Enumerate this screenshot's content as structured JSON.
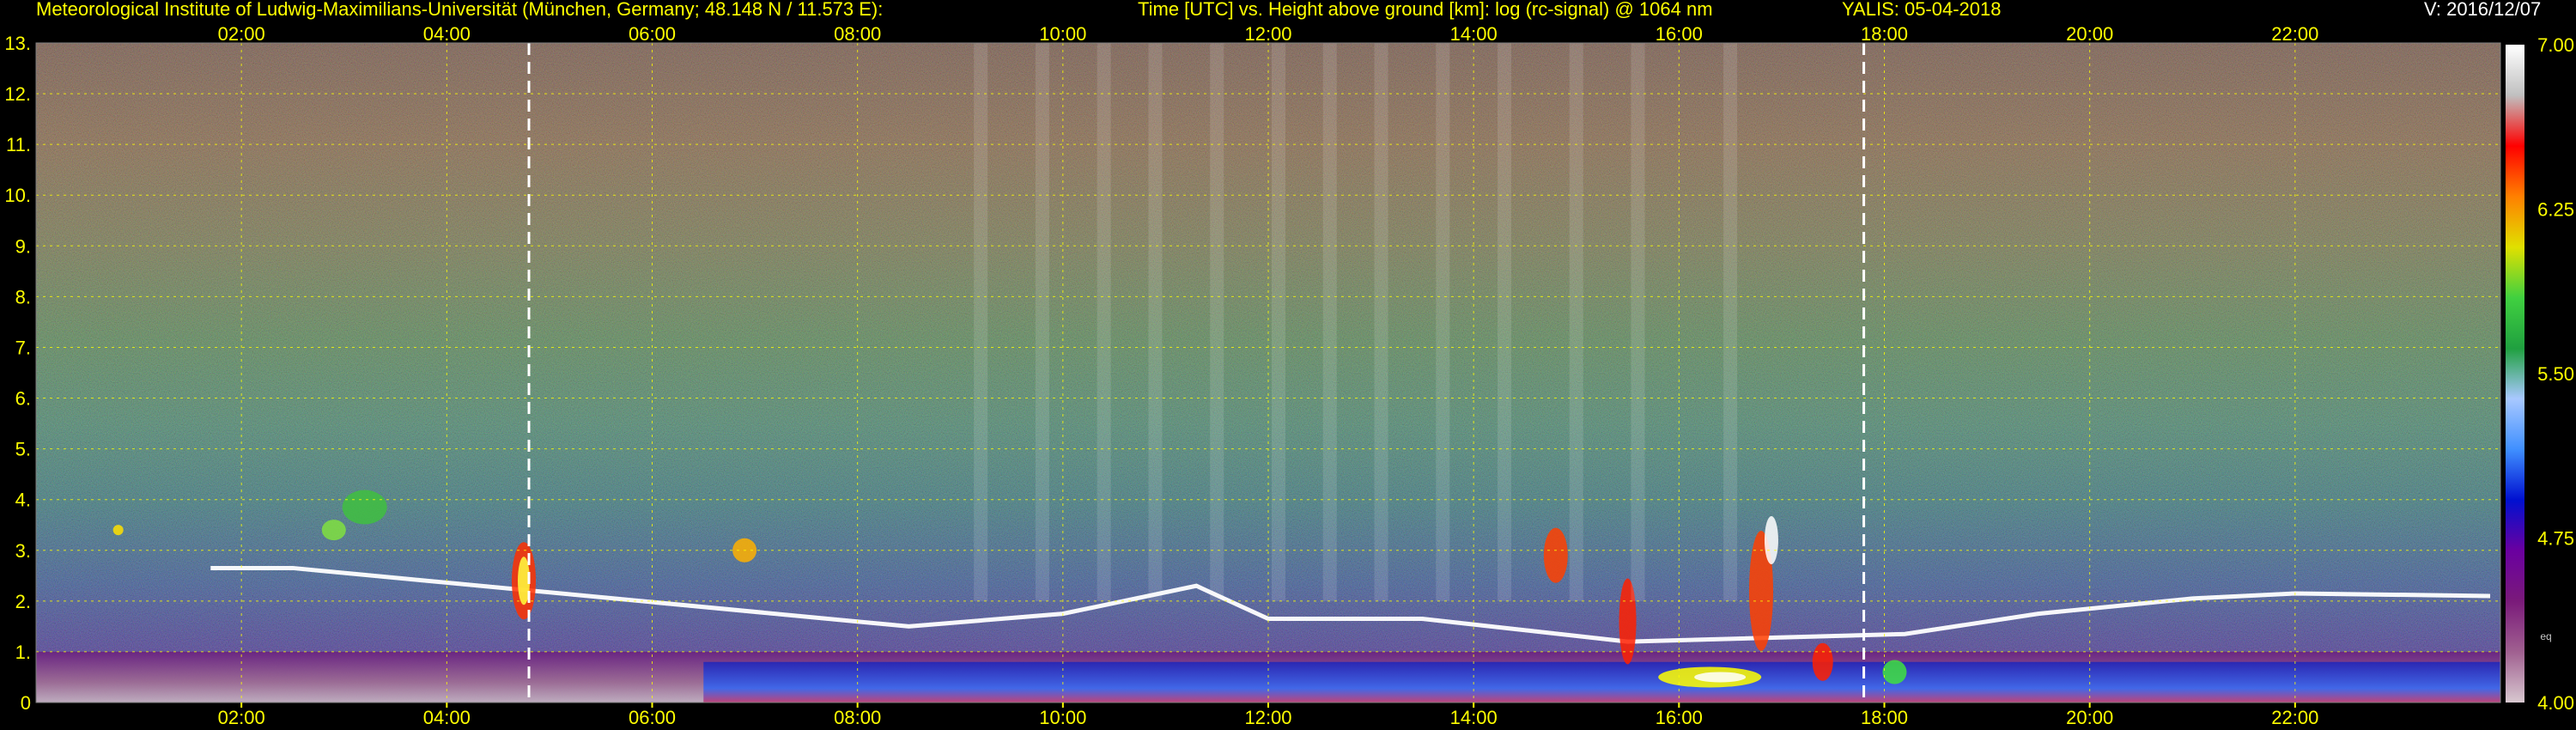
{
  "header": {
    "institute": "Meteorological Institute of Ludwig-Maximilians-Universität (München, Germany; 48.148 N / 11.573 E):",
    "title": "Time [UTC] vs. Height above ground [km]: log (rc-signal) @ 1064 nm",
    "station": "YALIS: 05-04-2018",
    "version": "V: 2016/12/07"
  },
  "colors": {
    "background": "#000000",
    "label_text": "#ffff00",
    "grid": "#ffff00",
    "marker_line": "#ffffff"
  },
  "chart_data": {
    "type": "heatmap",
    "title": "Time [UTC] vs. Height above ground [km]: log (rc-signal) @ 1064 nm",
    "xlabel": "Time [UTC]",
    "ylabel": "Height above ground [km]",
    "x_range_hours": [
      0,
      24
    ],
    "y_range_km": [
      0,
      13
    ],
    "x_ticks": [
      "02:00",
      "04:00",
      "06:00",
      "08:00",
      "10:00",
      "12:00",
      "14:00",
      "16:00",
      "18:00",
      "20:00",
      "22:00"
    ],
    "x_tick_hours": [
      2,
      4,
      6,
      8,
      10,
      12,
      14,
      16,
      18,
      20,
      22
    ],
    "y_ticks": [
      "0",
      "1.",
      "2.",
      "3.",
      "4.",
      "5.",
      "6.",
      "7.",
      "8.",
      "9.",
      "10.",
      "11.",
      "12.",
      "13."
    ],
    "y_tick_values": [
      0,
      1,
      2,
      3,
      4,
      5,
      6,
      7,
      8,
      9,
      10,
      11,
      12,
      13
    ],
    "grid": true,
    "vertical_markers_hours": [
      4.8,
      17.8
    ],
    "colorbar": {
      "range": [
        4.0,
        7.0
      ],
      "tick_labels": [
        "7.00",
        "6.25",
        "5.50",
        "4.75",
        "4.00"
      ],
      "tick_values": [
        7.0,
        6.25,
        5.5,
        4.75,
        4.0
      ],
      "unit": "eq",
      "stops": [
        "#d8c8d0",
        "#a06090",
        "#7a1a7a",
        "#6a00a0",
        "#0010d0",
        "#4090ff",
        "#a8c8ff",
        "#20a040",
        "#40d040",
        "#e0e000",
        "#ff8000",
        "#ff0000",
        "#c0c0c0",
        "#ffffff"
      ]
    },
    "boundary_layer_top_km": [
      {
        "hour": 1.7,
        "km": 2.65
      },
      {
        "hour": 2.5,
        "km": 2.65
      },
      {
        "hour": 8.5,
        "km": 1.5
      },
      {
        "hour": 10.0,
        "km": 1.75
      },
      {
        "hour": 11.3,
        "km": 2.3
      },
      {
        "hour": 12.0,
        "km": 1.65
      },
      {
        "hour": 13.5,
        "km": 1.65
      },
      {
        "hour": 15.5,
        "km": 1.2
      },
      {
        "hour": 18.2,
        "km": 1.35
      },
      {
        "hour": 19.5,
        "km": 1.75
      },
      {
        "hour": 21.0,
        "km": 2.05
      },
      {
        "hour": 22.0,
        "km": 2.15
      },
      {
        "hour": 23.9,
        "km": 2.1
      }
    ]
  }
}
